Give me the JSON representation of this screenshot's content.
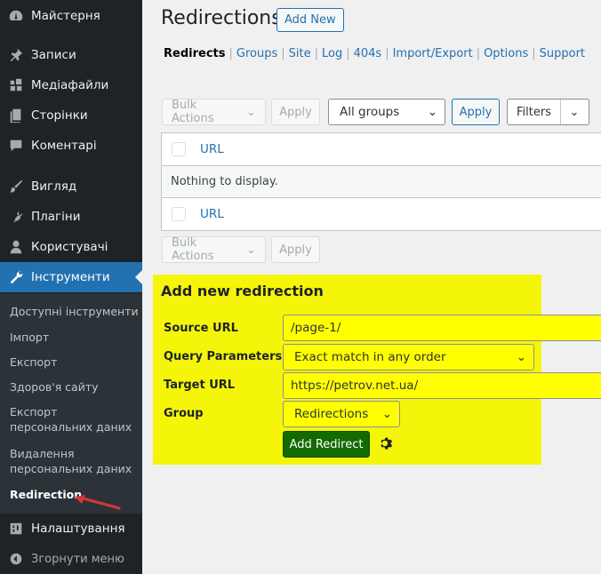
{
  "sidebar": {
    "items": [
      {
        "label": "Майстерня",
        "icon": "dashboard-icon"
      },
      {
        "label": "Записи",
        "icon": "pin-icon"
      },
      {
        "label": "Медіафайли",
        "icon": "media-icon"
      },
      {
        "label": "Сторінки",
        "icon": "pages-icon"
      },
      {
        "label": "Коментарі",
        "icon": "comments-icon"
      },
      {
        "label": "Вигляд",
        "icon": "brush-icon"
      },
      {
        "label": "Плагіни",
        "icon": "plugins-icon"
      },
      {
        "label": "Користувачі",
        "icon": "users-icon"
      },
      {
        "label": "Інструменти",
        "icon": "wrench-icon"
      },
      {
        "label": "Налаштування",
        "icon": "settings-icon"
      },
      {
        "label": "Згорнути меню",
        "icon": "collapse-icon"
      }
    ],
    "submenu": [
      "Доступні інструменти",
      "Імпорт",
      "Експорт",
      "Здоров'я сайту",
      "Експорт персональних даних",
      "Видалення персональних даних",
      "Redirection"
    ]
  },
  "header": {
    "title": "Redirections",
    "add_new": "Add New"
  },
  "tabs": [
    "Redirects",
    "Groups",
    "Site",
    "Log",
    "404s",
    "Import/Export",
    "Options",
    "Support"
  ],
  "toolbar": {
    "bulk_actions": "Bulk Actions",
    "apply": "Apply",
    "group_filter": "All groups",
    "apply_groups": "Apply",
    "filters": "Filters"
  },
  "table": {
    "column": "URL",
    "empty": "Nothing to display."
  },
  "form": {
    "title": "Add new redirection",
    "source_label": "Source URL",
    "source_value": "/page-1/",
    "query_label": "Query Parameters",
    "query_value": "Exact match in any order",
    "target_label": "Target URL",
    "target_value": "https://petrov.net.ua/",
    "group_label": "Group",
    "group_value": "Redirections",
    "submit": "Add Redirect"
  },
  "colors": {
    "sidebar_bg": "#1d2327",
    "accent": "#2271b1",
    "highlight": "#f5f50a",
    "submit_green": "#136a00",
    "arrow_red": "#d63638"
  }
}
